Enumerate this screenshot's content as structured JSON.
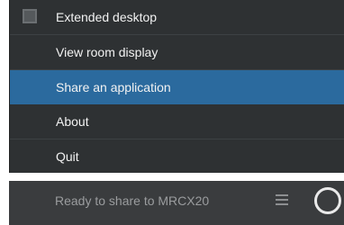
{
  "menu": {
    "items": [
      {
        "label": "Extended desktop",
        "has_checkbox": true,
        "checked": false
      },
      {
        "label": "View room display"
      },
      {
        "label": "Share an application",
        "selected": true
      },
      {
        "label": "About"
      },
      {
        "label": "Quit"
      }
    ]
  },
  "status": {
    "text": "Ready to share to MRCX20",
    "menu_icon": "hamburger-icon",
    "state_icon": "circle-icon"
  },
  "colors": {
    "menu_bg": "#2e3133",
    "selected_bg": "#2b6a9e",
    "status_bg": "#3a3c3e",
    "text": "#f2f2f2",
    "muted_text": "#9a9c9e"
  }
}
